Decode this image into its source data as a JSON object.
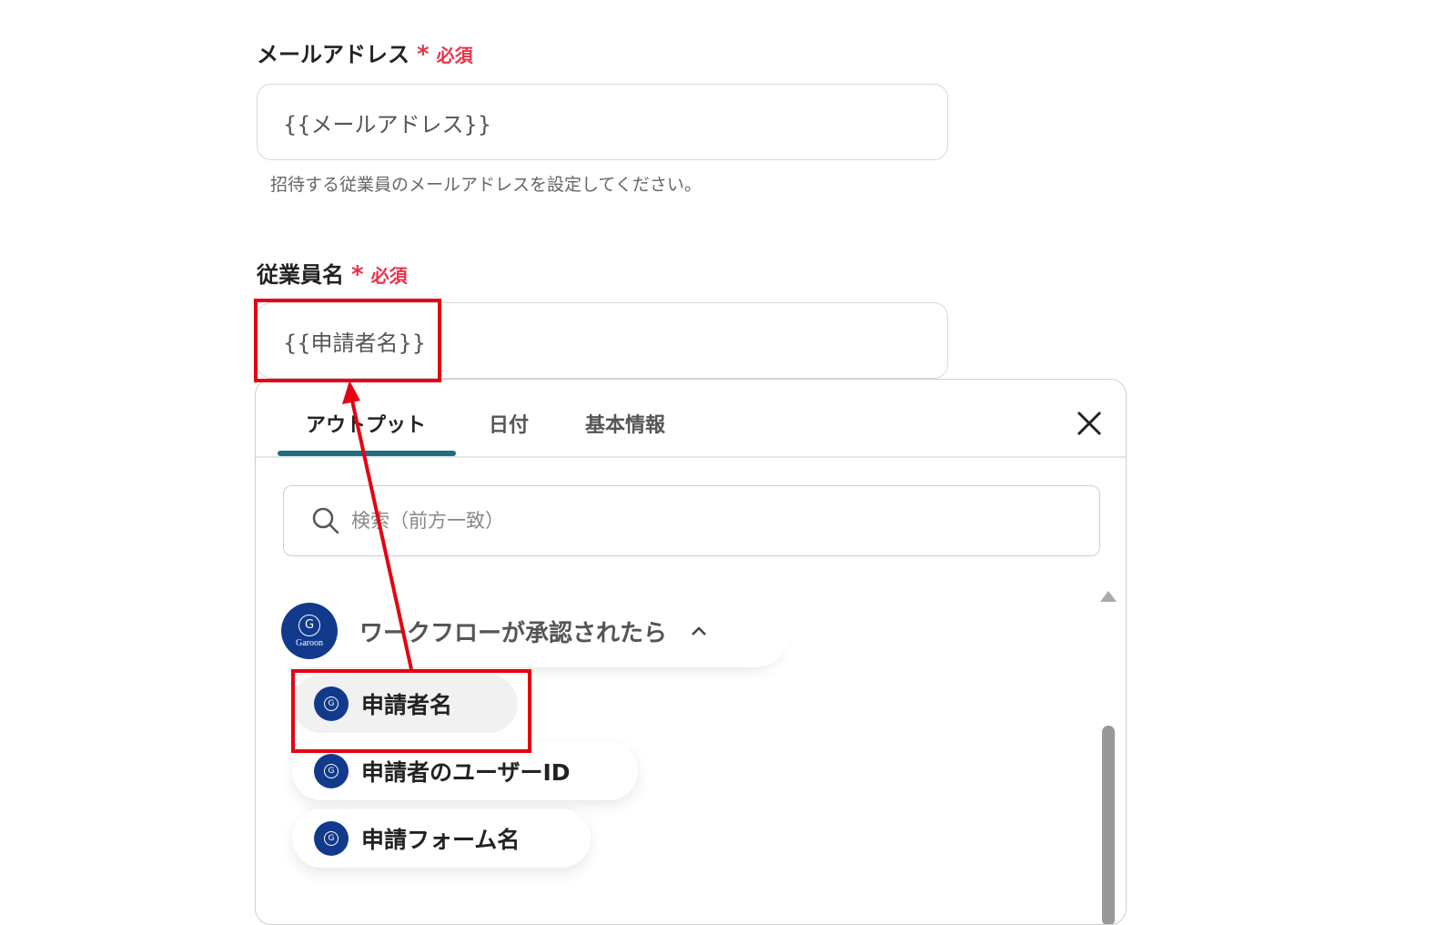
{
  "email_field": {
    "label": "メールアドレス",
    "required_star": "*",
    "required_text": "必須",
    "value": "{{メールアドレス}}",
    "help": "招待する従業員のメールアドレスを設定してください。"
  },
  "name_field": {
    "label": "従業員名",
    "required_star": "*",
    "required_text": "必須",
    "value": "{{申請者名}}"
  },
  "panel": {
    "tabs": [
      {
        "label": "アウトプット",
        "active": true
      },
      {
        "label": "日付",
        "active": false
      },
      {
        "label": "基本情報",
        "active": false
      }
    ],
    "close_icon": "close-icon",
    "search": {
      "placeholder": "検索（前方一致）",
      "icon": "search-icon"
    },
    "group": {
      "title": "ワークフローが承認されたら",
      "logo_letter": "G",
      "logo_brand": "Garoon",
      "expanded": true
    },
    "items": [
      {
        "label": "申請者名",
        "selected": true
      },
      {
        "label": "申請者のユーザーID",
        "selected": false
      },
      {
        "label": "申請フォーム名",
        "selected": false
      }
    ]
  },
  "annotation": {
    "highlight_color": "#e60012",
    "arrow": "from-selected-item-to-name-field"
  },
  "colors": {
    "accent": "#1f6f82",
    "required": "#e8334a",
    "garoon_blue": "#123a8c"
  }
}
